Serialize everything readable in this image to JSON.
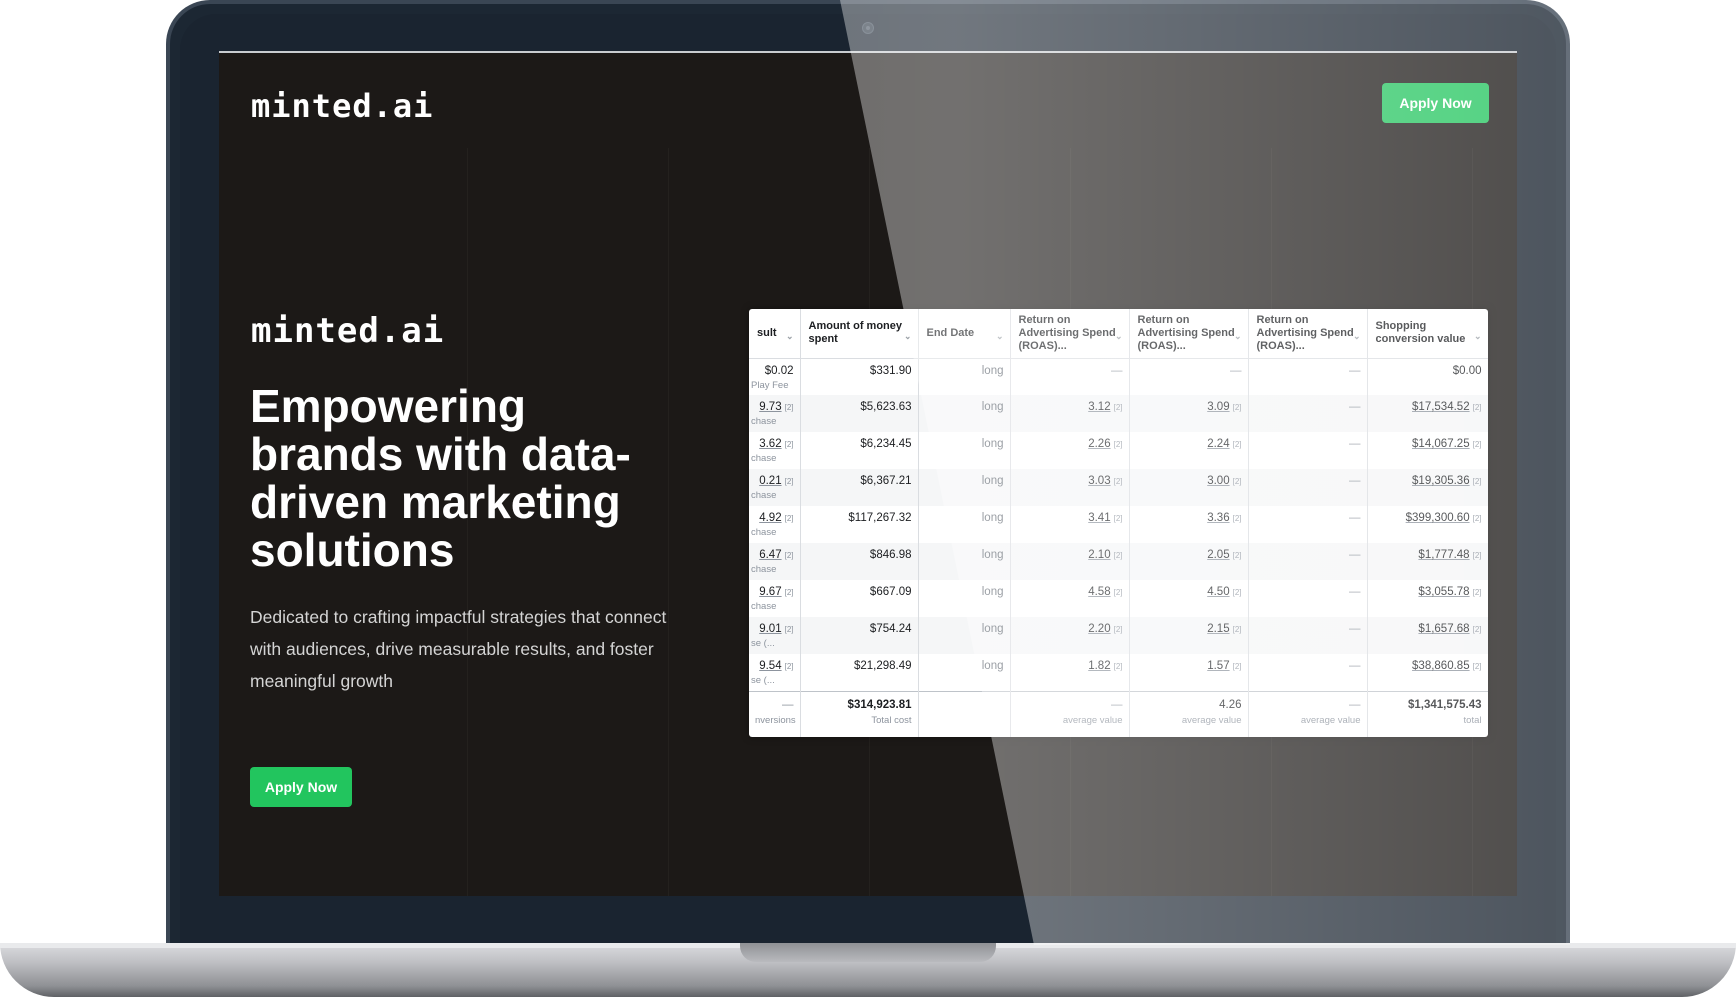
{
  "brand": {
    "logo_text": "minted.ai",
    "accent": "#22c55e"
  },
  "header": {
    "apply_label": "Apply Now"
  },
  "hero": {
    "logo_text": "minted.ai",
    "headline": "Empowering brands with data-driven marketing solutions",
    "subtext": "Dedicated to crafting impactful strategies that connect with audiences, drive measurable results, and foster meaningful growth",
    "apply_label": "Apply Now"
  },
  "table": {
    "headers": [
      "sult",
      "Amount of money spent",
      "End Date",
      "Return on Advertising Spend (ROAS)...",
      "Return on Advertising Spend (ROAS)...",
      "Return on Advertising Spend (ROAS)...",
      "Shopping conversion value"
    ],
    "rows": [
      {
        "result": "$0.02",
        "result_sub": "Play Fee",
        "spent": "$331.90",
        "end": "long",
        "roas1": "—",
        "roas2": "—",
        "roas3": "—",
        "conv": "$0.00"
      },
      {
        "result": "9.73",
        "result_sub": "chase",
        "spent": "$5,623.63",
        "end": "long",
        "roas1": "3.12",
        "roas2": "3.09",
        "roas3": "—",
        "conv": "$17,534.52"
      },
      {
        "result": "3.62",
        "result_sub": "chase",
        "spent": "$6,234.45",
        "end": "long",
        "roas1": "2.26",
        "roas2": "2.24",
        "roas3": "—",
        "conv": "$14,067.25"
      },
      {
        "result": "0.21",
        "result_sub": "chase",
        "spent": "$6,367.21",
        "end": "long",
        "roas1": "3.03",
        "roas2": "3.00",
        "roas3": "—",
        "conv": "$19,305.36"
      },
      {
        "result": "4.92",
        "result_sub": "chase",
        "spent": "$117,267.32",
        "end": "long",
        "roas1": "3.41",
        "roas2": "3.36",
        "roas3": "—",
        "conv": "$399,300.60"
      },
      {
        "result": "6.47",
        "result_sub": "chase",
        "spent": "$846.98",
        "end": "long",
        "roas1": "2.10",
        "roas2": "2.05",
        "roas3": "—",
        "conv": "$1,777.48"
      },
      {
        "result": "9.67",
        "result_sub": "chase",
        "spent": "$667.09",
        "end": "long",
        "roas1": "4.58",
        "roas2": "4.50",
        "roas3": "—",
        "conv": "$3,055.78"
      },
      {
        "result": "9.01",
        "result_sub": "se (...",
        "spent": "$754.24",
        "end": "long",
        "roas1": "2.20",
        "roas2": "2.15",
        "roas3": "—",
        "conv": "$1,657.68"
      },
      {
        "result": "9.54",
        "result_sub": "se (...",
        "spent": "$21,298.49",
        "end": "long",
        "roas1": "1.82",
        "roas2": "1.57",
        "roas3": "—",
        "conv": "$38,860.85"
      }
    ],
    "sup_mark": "[2]",
    "totals": {
      "result": "—",
      "result_sub": "nversions",
      "spent": "$314,923.81",
      "spent_sub": "Total cost",
      "roas1": "—",
      "roas1_sub": "average value",
      "roas2": "4.26",
      "roas2_sub": "average value",
      "roas3": "—",
      "roas3_sub": "average value",
      "conv": "$1,341,575.43",
      "conv_sub": "total"
    }
  }
}
